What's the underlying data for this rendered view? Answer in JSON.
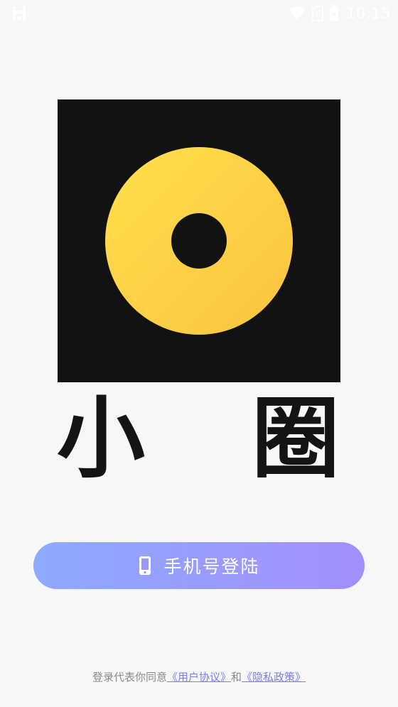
{
  "status_bar": {
    "left_icon": "app-notification-icon",
    "icons": [
      "wifi-icon",
      "sim-card-icon",
      "battery-icon"
    ],
    "time": "10:15"
  },
  "logo": {
    "icon": "ring-logo-icon",
    "colors": {
      "background": "#121212",
      "ring_start": "#ffde4b",
      "ring_end": "#fbc640"
    }
  },
  "app_name": {
    "char1": "小",
    "char2": "圈"
  },
  "login_button": {
    "label": "手机号登陆",
    "icon": "phone-icon",
    "gradient_start": "#8eaafe",
    "gradient_end": "#a28ffc"
  },
  "agreement": {
    "prefix": "登录代表你同意",
    "user_agreement": "《用户协议》",
    "connector": "和",
    "privacy_policy": "《隐私政策》"
  }
}
